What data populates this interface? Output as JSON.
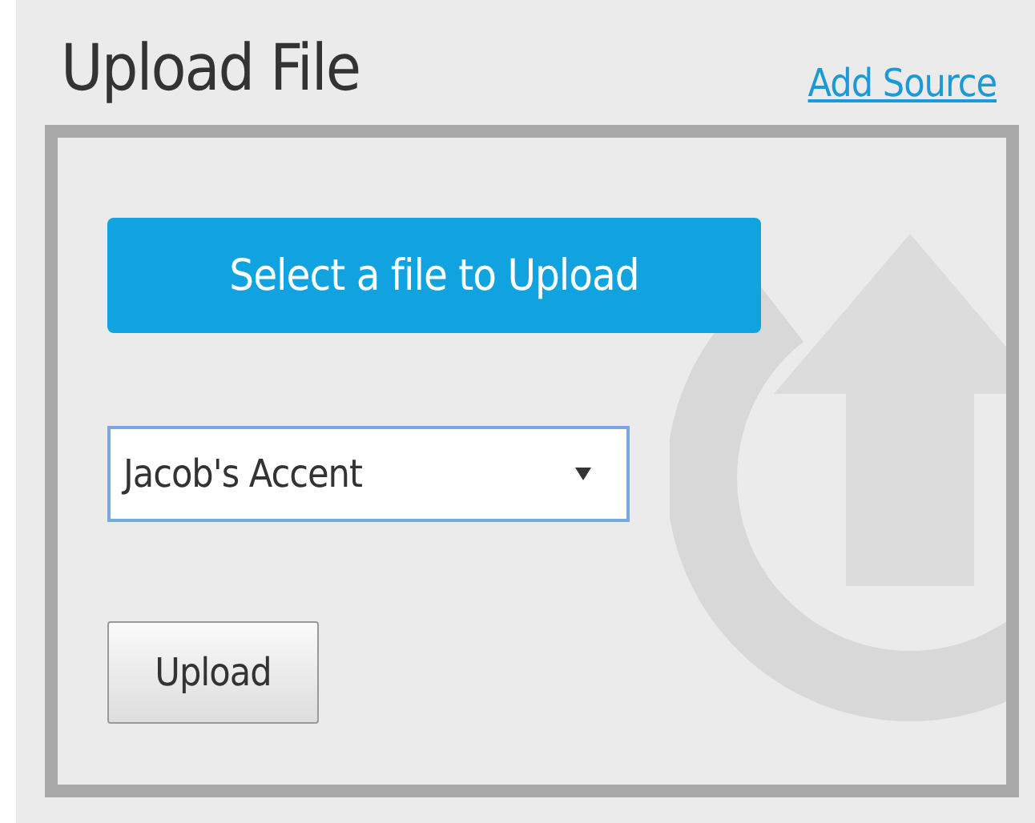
{
  "title": "Upload File",
  "add_source_link": "Add Source",
  "select_file_button": "Select a file to Upload",
  "source_select": {
    "value": "Jacob's Accent"
  },
  "upload_button": "Upload"
}
